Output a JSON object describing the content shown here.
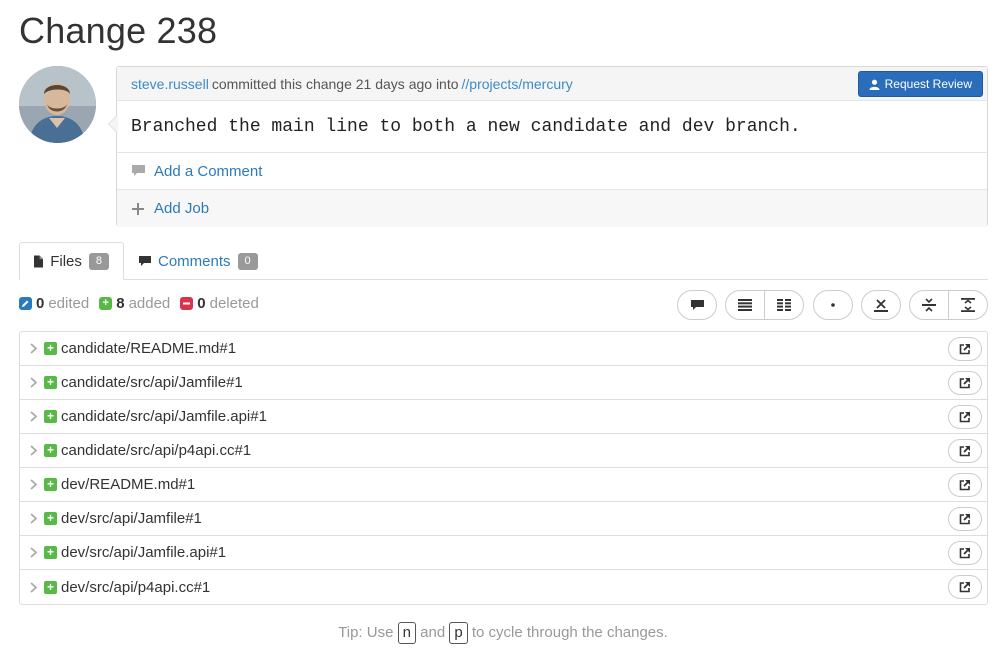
{
  "page": {
    "title": "Change 238"
  },
  "commit": {
    "author": "steve.russell",
    "committed_text": "committed this change 21 days ago into",
    "path": "//projects/mercury",
    "request_review_label": "Request Review",
    "description": "Branched the main line to both a new candidate and dev branch.",
    "add_comment_label": "Add a Comment",
    "add_job_label": "Add Job"
  },
  "tabs": [
    {
      "label": "Files",
      "count": "8",
      "icon": "file-icon"
    },
    {
      "label": "Comments",
      "count": "0",
      "icon": "comment-icon"
    }
  ],
  "stats": {
    "edited_count": "0",
    "edited_label": "edited",
    "added_count": "8",
    "added_label": "added",
    "deleted_count": "0",
    "deleted_label": "deleted"
  },
  "toolbar_icons": [
    "comment-icon",
    "list-icon",
    "columns-icon",
    "dot-icon",
    "collapse-icon",
    "strikethrough-icon",
    "expand-icon"
  ],
  "files": [
    "candidate/README.md#1",
    "candidate/src/api/Jamfile#1",
    "candidate/src/api/Jamfile.api#1",
    "candidate/src/api/p4api.cc#1",
    "dev/README.md#1",
    "dev/src/api/Jamfile#1",
    "dev/src/api/Jamfile.api#1",
    "dev/src/api/p4api.cc#1"
  ],
  "tip": {
    "prefix": "Tip: Use",
    "key1": "n",
    "middle": "and",
    "key2": "p",
    "suffix": "to cycle through the changes."
  },
  "colors": {
    "accent": "#2a6ebb",
    "link": "#2a7bbd",
    "added": "#58b947",
    "edited": "#2a7bbd",
    "deleted": "#d9344e"
  }
}
